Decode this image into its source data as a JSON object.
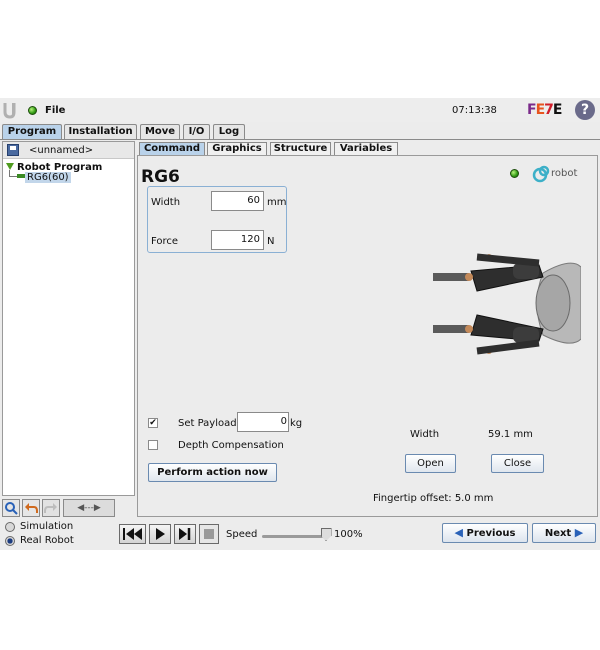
{
  "titlebar": {
    "file_label": "File",
    "clock": "07:13:38",
    "brand_logo": "FE7E"
  },
  "main_tabs": [
    "Program",
    "Installation",
    "Move",
    "I/O",
    "Log"
  ],
  "program_tree": {
    "program_name": "<unnamed>",
    "root": "Robot Program",
    "node": "RG6(60)"
  },
  "sub_tabs": [
    "Command",
    "Graphics",
    "Structure",
    "Variables"
  ],
  "command": {
    "title": "RG6",
    "brand": "robot",
    "width_label": "Width",
    "width_value": "60",
    "width_unit": "mm",
    "force_label": "Force",
    "force_value": "120",
    "force_unit": "N",
    "set_payload_label": "Set Payload:",
    "payload_value": "0",
    "payload_unit": "kg",
    "set_payload_checked": true,
    "depth_comp_label": "Depth Compensation",
    "depth_comp_checked": false,
    "perform_label": "Perform action now",
    "status_width_label": "Width",
    "status_width_value": "59.1 mm",
    "open_label": "Open",
    "close_label": "Close",
    "fingertip_offset": "Fingertip offset: 5.0 mm"
  },
  "left_toolbar": {
    "nav_label": "◀---▶"
  },
  "bottom": {
    "simulation_label": "Simulation",
    "real_robot_label": "Real Robot",
    "mode_selected": "Real Robot",
    "speed_label": "Speed",
    "speed_value": "100%",
    "speed_fraction": 1.0,
    "previous_label": "Previous",
    "next_label": "Next"
  },
  "colors": {
    "active_tab": "#b9d2ea",
    "status_led": "#2f9a12",
    "accent_blue": "#2a62b8"
  }
}
